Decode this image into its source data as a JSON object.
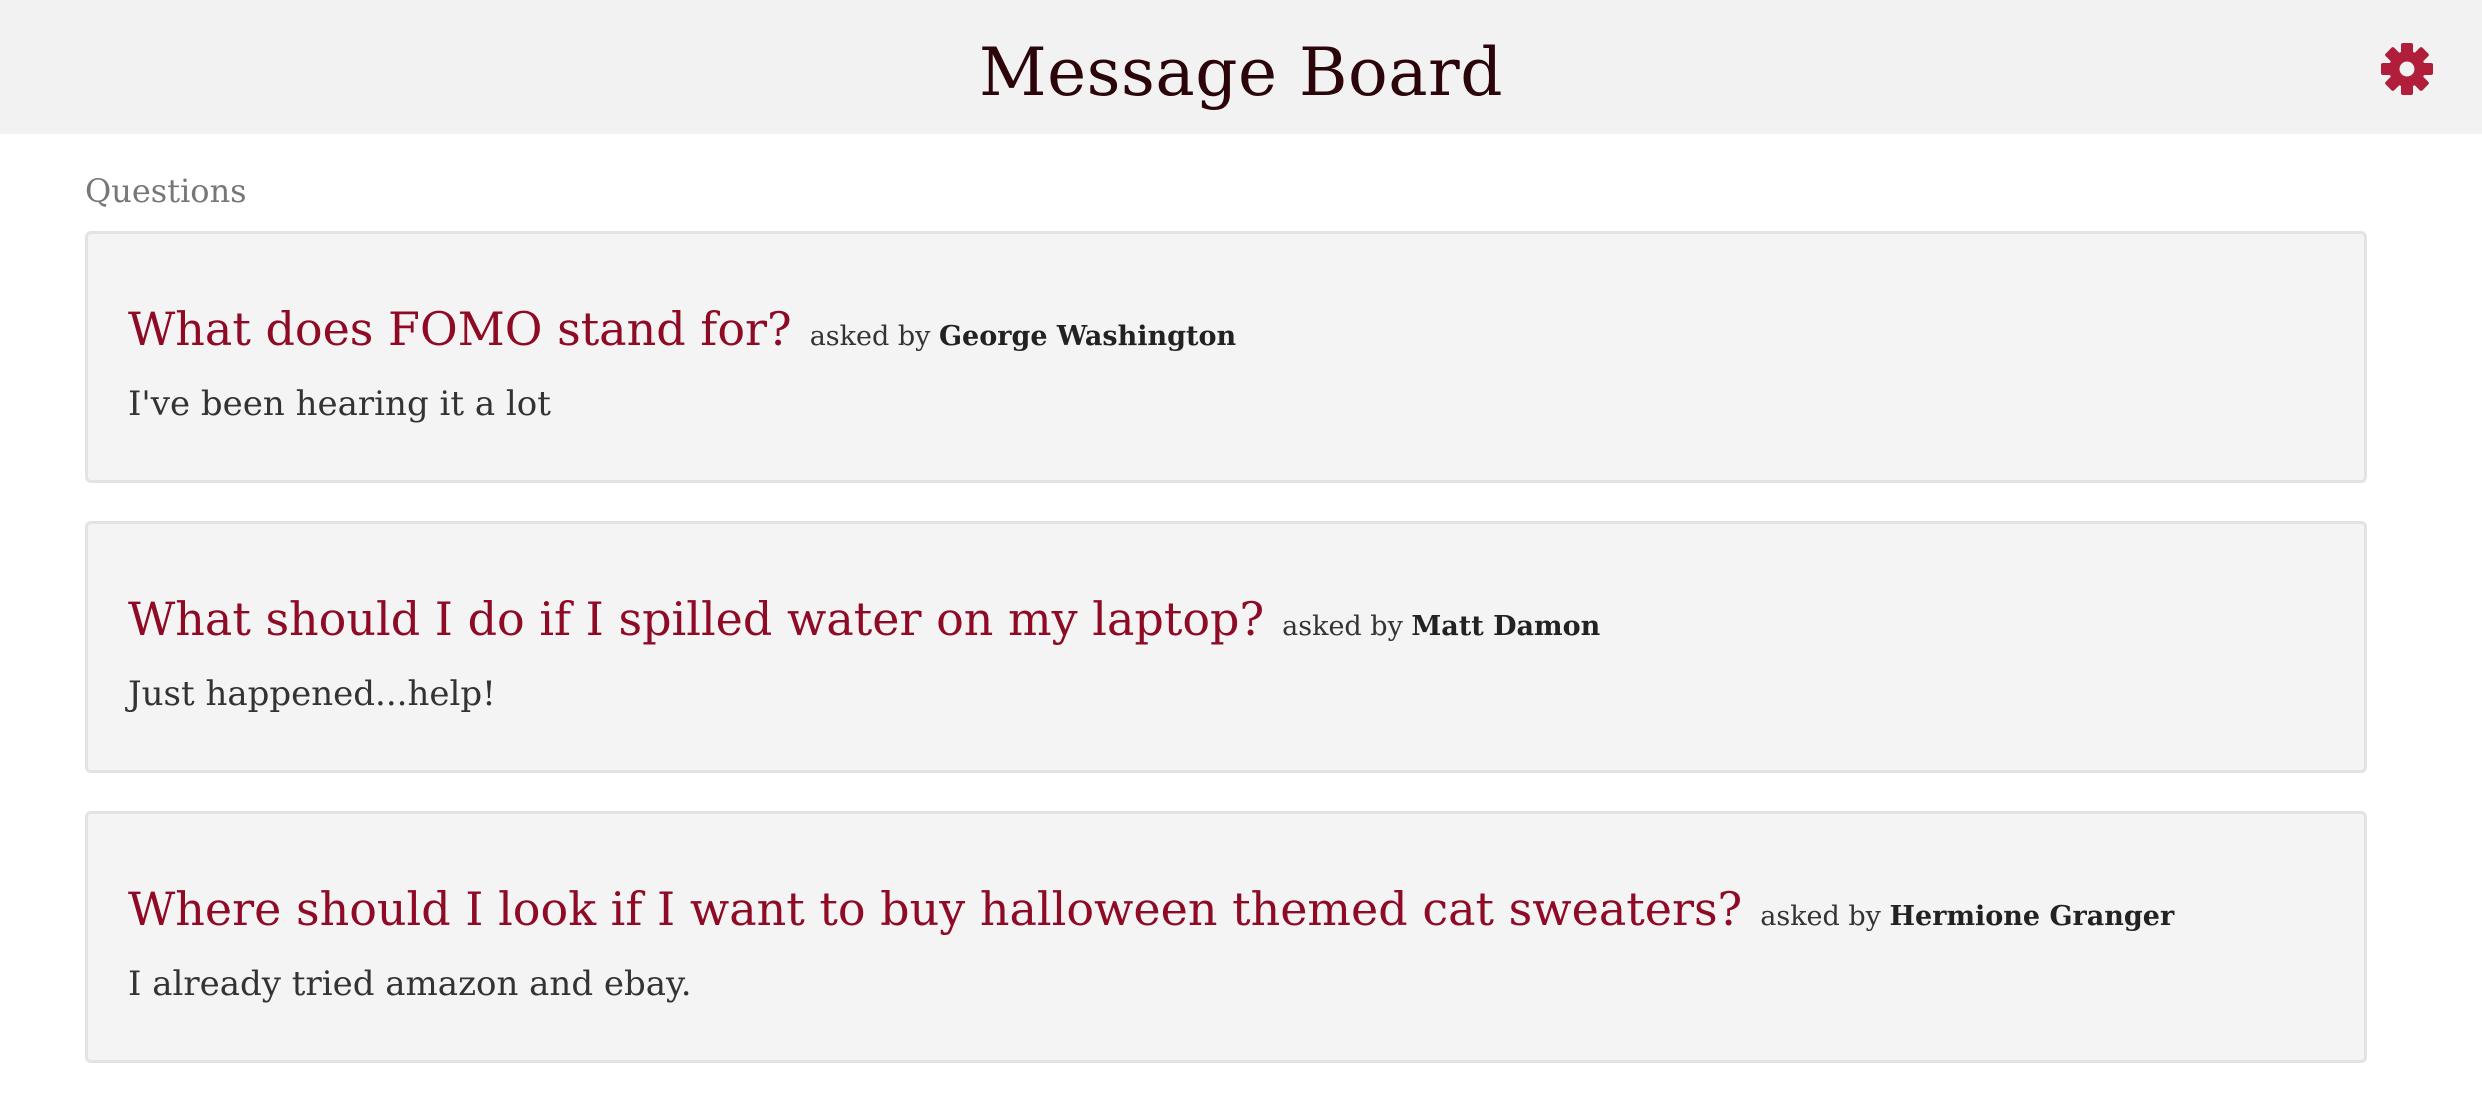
{
  "header": {
    "title": "Message Board",
    "settings_icon": "gear-icon",
    "accent_color": "#b01e3c"
  },
  "section": {
    "label": "Questions"
  },
  "questions": [
    {
      "title": "What does FOMO stand for?",
      "asked_by_label": "asked by",
      "author": "George Washington",
      "body": "I've been hearing it a lot"
    },
    {
      "title": "What should I do if I spilled water on my laptop?",
      "asked_by_label": "asked by",
      "author": "Matt Damon",
      "body": "Just happened...help!"
    },
    {
      "title": "Where should I look if I want to buy halloween themed cat sweaters?",
      "asked_by_label": "asked by",
      "author": "Hermione Granger",
      "body": "I already tried amazon and ebay."
    }
  ]
}
